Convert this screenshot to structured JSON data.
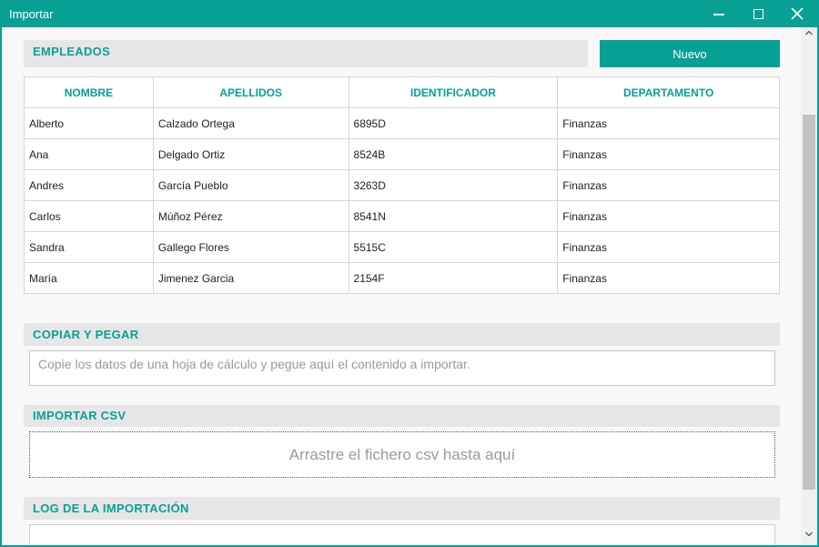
{
  "window": {
    "title": "Importar",
    "accent_color": "#08a095"
  },
  "empleados": {
    "header": "EMPLEADOS",
    "new_button_label": "Nuevo",
    "columns": [
      "NOMBRE",
      "APELLIDOS",
      "IDENTIFICADOR",
      "DEPARTAMENTO"
    ],
    "rows": [
      [
        "Alberto",
        "Calzado Ortega",
        "6895D",
        "Finanzas"
      ],
      [
        "Ana",
        "Delgado Ortiz",
        "8524B",
        "Finanzas"
      ],
      [
        "Andres",
        "García Pueblo",
        "3263D",
        "Finanzas"
      ],
      [
        "Carlos",
        "Múñoz Pérez",
        "8541N",
        "Finanzas"
      ],
      [
        "Sandra",
        "Gallego Flores",
        "5515C",
        "Finanzas"
      ],
      [
        "María",
        "Jimenez Garcia",
        "2154F",
        "Finanzas"
      ]
    ]
  },
  "copiar": {
    "header": "COPIAR Y PEGAR",
    "placeholder": "Copie los datos de una hoja de cálculo y pegue aquí el contenido a importar."
  },
  "csv": {
    "header": "IMPORTAR CSV",
    "drop_text": "Arrastre el fichero csv hasta aquí"
  },
  "log": {
    "header": "LOG DE LA IMPORTACIÓN"
  },
  "icons": {
    "minimize": "minimize-icon",
    "maximize": "maximize-icon",
    "close": "close-icon",
    "scroll_up": "chevron-up-icon",
    "scroll_down": "chevron-down-icon"
  }
}
